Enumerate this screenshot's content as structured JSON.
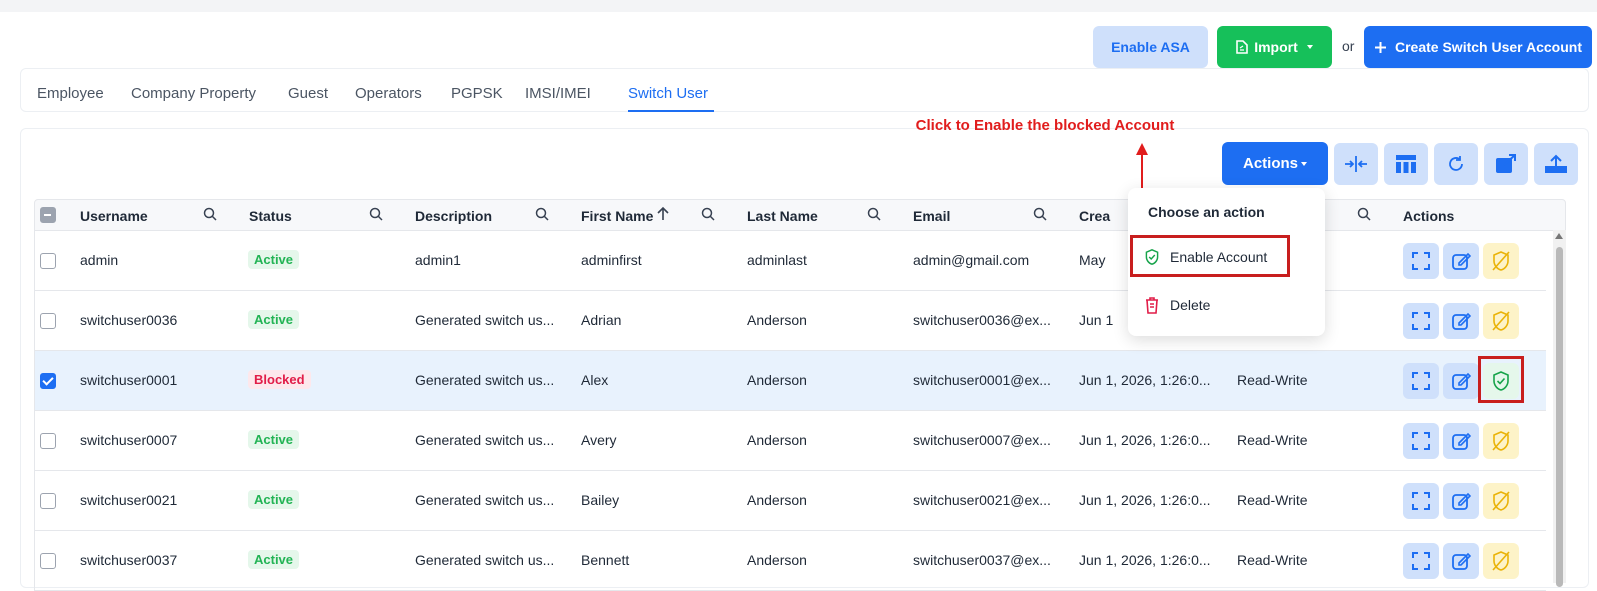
{
  "toolbar": {
    "enable_asa_label": "Enable ASA",
    "import_label": "Import",
    "or_text": "or",
    "create_label": "Create Switch User Account"
  },
  "tabs": [
    "Employee",
    "Company Property",
    "Guest",
    "Operators",
    "PGPSK",
    "IMSI/IMEI",
    "Switch User"
  ],
  "active_tab": "Switch User",
  "annotation": {
    "text": "Click to Enable the blocked Account",
    "color": "#e11d1d"
  },
  "actions_button": {
    "label": "Actions"
  },
  "tools": [
    "collapse-columns-icon",
    "columns-layout-icon",
    "refresh-icon",
    "export-icon",
    "upload-icon"
  ],
  "dropdown": {
    "title": "Choose an action",
    "items": [
      {
        "label": "Enable Account",
        "icon": "shield-check-icon"
      },
      {
        "label": "Delete",
        "icon": "trash-icon"
      }
    ]
  },
  "table": {
    "columns": [
      "Username",
      "Status",
      "Description",
      "First Name",
      "Last Name",
      "Email",
      "Crea",
      "",
      "Actions"
    ],
    "rows": [
      {
        "username": "admin",
        "status": "Active",
        "description": "admin1",
        "first_name": "adminfirst",
        "last_name": "adminlast",
        "email": "admin@gmail.com",
        "created": "May",
        "access": "",
        "checked": false
      },
      {
        "username": "switchuser0036",
        "status": "Active",
        "description": "Generated switch us...",
        "first_name": "Adrian",
        "last_name": "Anderson",
        "email": "switchuser0036@ex...",
        "created": "Jun 1",
        "access": "",
        "checked": false
      },
      {
        "username": "switchuser0001",
        "status": "Blocked",
        "description": "Generated switch us...",
        "first_name": "Alex",
        "last_name": "Anderson",
        "email": "switchuser0001@ex...",
        "created": "Jun 1, 2026, 1:26:0...",
        "access": "Read-Write",
        "checked": true
      },
      {
        "username": "switchuser0007",
        "status": "Active",
        "description": "Generated switch us...",
        "first_name": "Avery",
        "last_name": "Anderson",
        "email": "switchuser0007@ex...",
        "created": "Jun 1, 2026, 1:26:0...",
        "access": "Read-Write",
        "checked": false
      },
      {
        "username": "switchuser0021",
        "status": "Active",
        "description": "Generated switch us...",
        "first_name": "Bailey",
        "last_name": "Anderson",
        "email": "switchuser0021@ex...",
        "created": "Jun 1, 2026, 1:26:0...",
        "access": "Read-Write",
        "checked": false
      },
      {
        "username": "switchuser0037",
        "status": "Active",
        "description": "Generated switch us...",
        "first_name": "Bennett",
        "last_name": "Anderson",
        "email": "switchuser0037@ex...",
        "created": "Jun 1, 2026, 1:26:0...",
        "access": "Read-Write",
        "checked": false
      }
    ]
  },
  "colors": {
    "primary": "#1d6ef2",
    "success": "#16c05a",
    "danger": "#e11d48",
    "warning": "#eab308",
    "highlight_box": "#c81e1e"
  }
}
